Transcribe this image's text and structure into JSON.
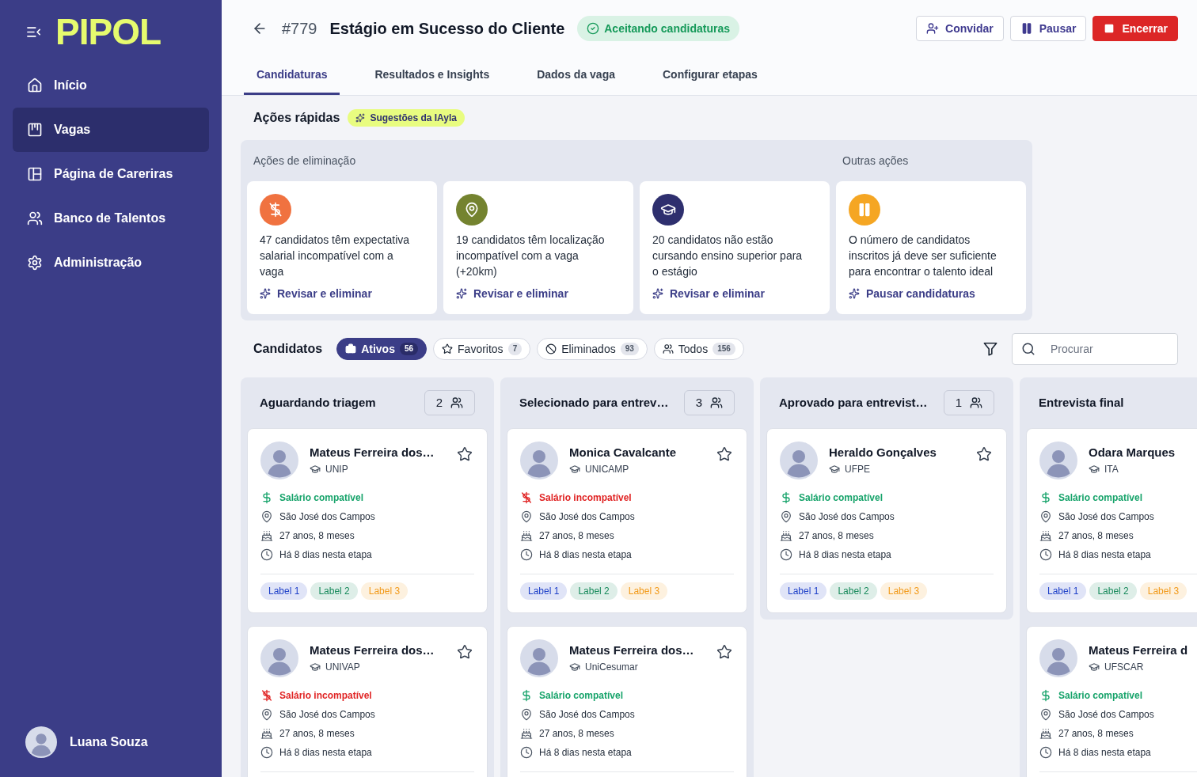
{
  "sidebar": {
    "logo": "PIPOL",
    "items": [
      {
        "kind": "home",
        "label": "Início",
        "selected": false
      },
      {
        "kind": "jobs",
        "label": "Vagas",
        "selected": true
      },
      {
        "kind": "careers",
        "label": "Página de Careriras",
        "selected": false
      },
      {
        "kind": "talents",
        "label": "Banco de Talentos",
        "selected": false
      },
      {
        "kind": "admin",
        "label": "Administração",
        "selected": false
      }
    ],
    "user": {
      "name": "Luana Souza"
    }
  },
  "header": {
    "job_id": "#779",
    "title": "Estágio em Sucesso do Cliente",
    "status": "Aceitando candidaturas",
    "actions": [
      {
        "kind": "invite",
        "label": "Convidar"
      },
      {
        "kind": "pause",
        "label": "Pausar"
      },
      {
        "kind": "end",
        "label": "Encerrar"
      }
    ]
  },
  "tabs": [
    {
      "label": "Candidaturas",
      "selected": true
    },
    {
      "label": "Resultados e Insights",
      "selected": false
    },
    {
      "label": "Dados da vaga",
      "selected": false
    },
    {
      "label": "Configurar etapas",
      "selected": false
    }
  ],
  "quick_actions": {
    "title": "Ações rápidas",
    "badge": "Sugestões da IAyla",
    "groups": [
      {
        "title": "Ações de eliminação",
        "cards": [
          {
            "kind": "salary",
            "color": "#f07240",
            "text": "47 candidatos têm expectativa salarial incompatível com a vaga",
            "action": "Revisar e eliminar"
          },
          {
            "kind": "location",
            "color": "#74832f",
            "text": "19 candidatos têm localização incompatível com a vaga (+20km)",
            "action": "Revisar e eliminar"
          },
          {
            "kind": "education",
            "color": "#2e2f6e",
            "text": "20 candidatos não estão cursando ensino superior para o estágio",
            "action": "Revisar e eliminar"
          }
        ]
      },
      {
        "title": "Outras ações",
        "cards": [
          {
            "kind": "pause",
            "color": "#f5a623",
            "text": "O número de candidatos inscritos já deve ser suficiente para encontrar o talento ideal",
            "action": "Pausar candidaturas"
          }
        ]
      }
    ]
  },
  "candidates": {
    "title": "Candidatos",
    "filters": [
      {
        "kind": "active",
        "label": "Ativos",
        "count": "56",
        "selected": true
      },
      {
        "kind": "favorites",
        "label": "Favoritos",
        "count": "7",
        "selected": false
      },
      {
        "kind": "eliminated",
        "label": "Eliminados",
        "count": "93",
        "selected": false
      },
      {
        "kind": "all",
        "label": "Todos",
        "count": "156",
        "selected": false
      }
    ],
    "search": {
      "placeholder": "Procurar"
    }
  },
  "columns": [
    {
      "title": "Aguardando triagem",
      "count": "2",
      "candidates": [
        {
          "name": "Mateus Ferreira dos…",
          "school": "UNIP",
          "starred": false,
          "salary": {
            "text": "Salário compatível",
            "compatible": true
          },
          "location": "São José dos Campos",
          "age": "27 anos, 8 meses",
          "stage_time": "Há 8 dias nesta etapa",
          "labels": [
            {
              "text": "Label 1",
              "color": "#1e40c8"
            },
            {
              "text": "Label 2",
              "color": "#16895a"
            },
            {
              "text": "Label 3",
              "color": "#f29a1a"
            }
          ]
        },
        {
          "name": "Mateus Ferreira dos…",
          "school": "UNIVAP",
          "starred": false,
          "salary": {
            "text": "Salário incompatível",
            "compatible": false
          },
          "location": "São José dos Campos",
          "age": "27 anos, 8 meses",
          "stage_time": "Há 8 dias nesta etapa"
        }
      ]
    },
    {
      "title": "Selecionado para entrev…",
      "count": "3",
      "candidates": [
        {
          "name": "Monica Cavalcante",
          "school": "UNICAMP",
          "starred": false,
          "salary": {
            "text": "Salário incompatível",
            "compatible": false
          },
          "location": "São José dos Campos",
          "age": "27 anos, 8 meses",
          "stage_time": "Há 8 dias nesta etapa",
          "labels": [
            {
              "text": "Label 1",
              "color": "#1e40c8"
            },
            {
              "text": "Label 2",
              "color": "#16895a"
            },
            {
              "text": "Label 3",
              "color": "#f29a1a"
            }
          ]
        },
        {
          "name": "Mateus Ferreira dos…",
          "school": "UniCesumar",
          "starred": false,
          "salary": {
            "text": "Salário compatível",
            "compatible": true
          },
          "location": "São José dos Campos",
          "age": "27 anos, 8 meses",
          "stage_time": "Há 8 dias nesta etapa"
        }
      ]
    },
    {
      "title": "Aprovado para entrevist…",
      "count": "1",
      "candidates": [
        {
          "name": "Heraldo Gonçalves",
          "school": "UFPE",
          "starred": false,
          "salary": {
            "text": "Salário compatível",
            "compatible": true
          },
          "location": "São José dos Campos",
          "age": "27 anos, 8 meses",
          "stage_time": "Há 8 dias nesta etapa",
          "labels": [
            {
              "text": "Label 1",
              "color": "#1e40c8"
            },
            {
              "text": "Label 2",
              "color": "#16895a"
            },
            {
              "text": "Label 3",
              "color": "#f29a1a"
            }
          ]
        }
      ]
    },
    {
      "title": "Entrevista final",
      "candidates": [
        {
          "name": "Odara Marques",
          "school": "ITA",
          "salary": {
            "text": "Salário compatível",
            "compatible": true
          },
          "location": "São José dos Campos",
          "age": "27 anos, 8 meses",
          "stage_time": "Há 8 dias nesta etapa",
          "labels": [
            {
              "text": "Label 1",
              "color": "#1e40c8"
            },
            {
              "text": "Label 2",
              "color": "#16895a"
            },
            {
              "text": "Label 3",
              "color": "#f29a1a"
            }
          ]
        },
        {
          "name": "Mateus Ferreira d",
          "school": "UFSCAR",
          "salary": {
            "text": "Salário compatível",
            "compatible": true
          },
          "location": "São José dos Campos",
          "age": "27 anos, 8 meses",
          "stage_time": "Há 8 dias nesta etapa"
        }
      ]
    }
  ]
}
